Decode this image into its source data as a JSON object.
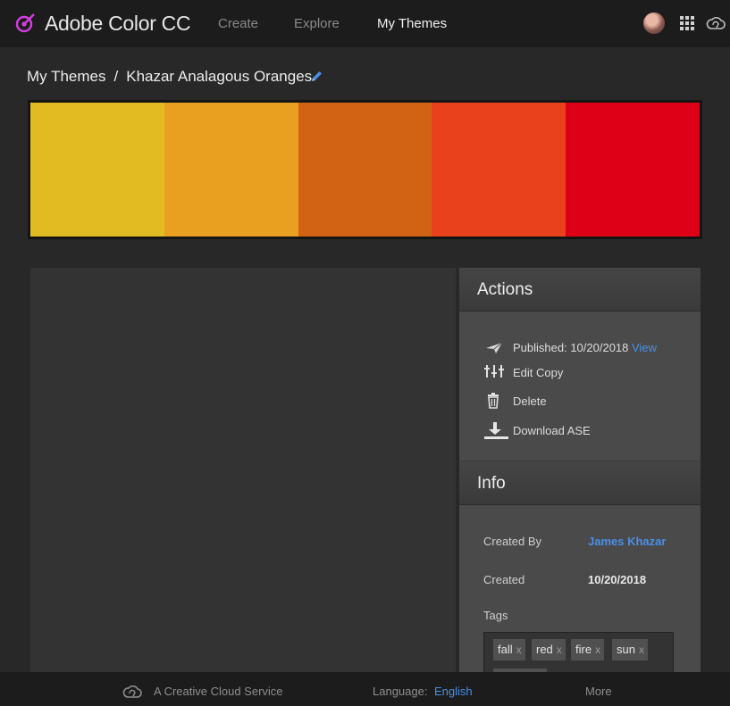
{
  "app": {
    "title": "Adobe Color CC"
  },
  "nav": [
    {
      "label": "Create"
    },
    {
      "label": "Explore"
    },
    {
      "label": "My Themes"
    }
  ],
  "breadcrumb": {
    "parent": "My Themes",
    "separator": "/",
    "current": "Khazar Analagous Oranges"
  },
  "swatches": [
    "#E2BB22",
    "#E9A021",
    "#D36314",
    "#E8411B",
    "#DE0016"
  ],
  "actions": {
    "title": "Actions",
    "published_label": "Published: 10/20/2018",
    "view_link": "View",
    "edit_copy": "Edit Copy",
    "delete": "Delete",
    "download_ase": "Download ASE"
  },
  "info": {
    "title": "Info",
    "created_by_label": "Created By",
    "created_by_value": "James Khazar",
    "created_label": "Created",
    "created_value": "10/20/2018",
    "tags_label": "Tags",
    "tags": [
      "fall",
      "red",
      "fire",
      "sun"
    ],
    "tag_remove_glyph": "x"
  },
  "footer": {
    "service": "A Creative Cloud Service",
    "language_label": "Language:",
    "language_value": "English",
    "more": "More"
  },
  "colors": {
    "accent_link": "#4a8fe6",
    "brand_icon": "#d23ee0"
  }
}
